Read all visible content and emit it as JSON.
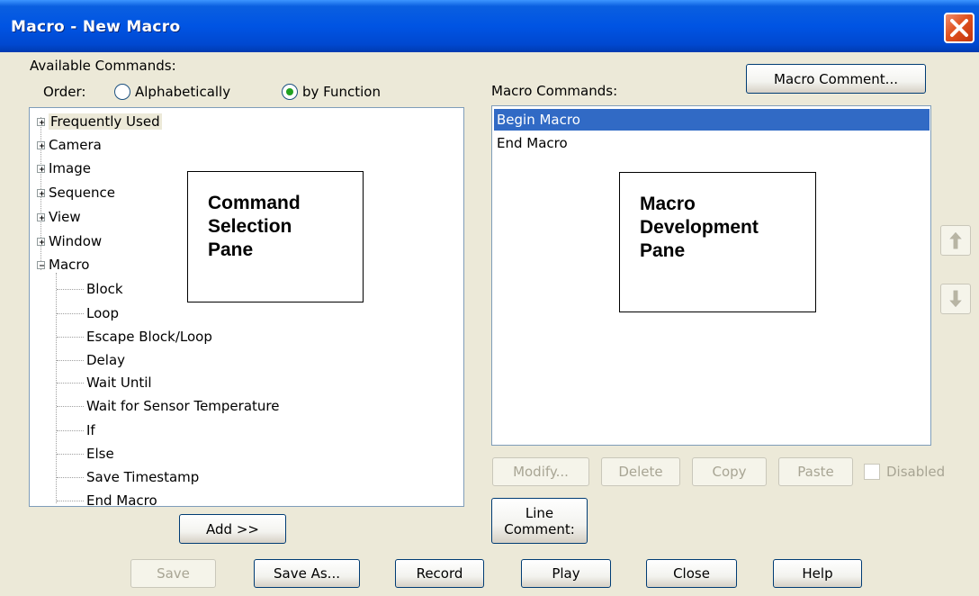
{
  "window": {
    "title": "Macro - New Macro",
    "close_icon": "close-icon"
  },
  "available": {
    "label": "Available Commands:",
    "order_label": "Order:",
    "radio_alpha": "Alphabetically",
    "radio_function": "by Function",
    "selected_order": "by Function"
  },
  "tree": {
    "categories": [
      "Frequently Used",
      "Camera",
      "Image",
      "Sequence",
      "View",
      "Window",
      "Macro"
    ],
    "macro_children": [
      "Block",
      "Loop",
      "Escape Block/Loop",
      "Delay",
      "Wait Until",
      "Wait for Sensor Temperature",
      "If",
      "Else",
      "Save Timestamp",
      "End Macro"
    ]
  },
  "annotations": {
    "command_pane": [
      "Command",
      "Selection",
      "Pane"
    ],
    "macro_pane": [
      "Macro",
      "Development",
      "Pane"
    ]
  },
  "macro_commands": {
    "label": "Macro Commands:",
    "items": [
      "Begin Macro",
      "End Macro"
    ],
    "selected": "Begin Macro"
  },
  "buttons": {
    "macro_comment": "Macro Comment...",
    "add": "Add >>",
    "modify": "Modify...",
    "delete": "Delete",
    "copy": "Copy",
    "paste": "Paste",
    "disabled": "Disabled",
    "line_comment_1": "Line",
    "line_comment_2": "Comment:",
    "save": "Save",
    "save_as": "Save As...",
    "record": "Record",
    "play": "Play",
    "close": "Close",
    "help": "Help"
  },
  "colors": {
    "title_bar": "#0054e3",
    "selection": "#316ac5",
    "close_button": "#e0521f",
    "radio_selected": "#21a121"
  }
}
